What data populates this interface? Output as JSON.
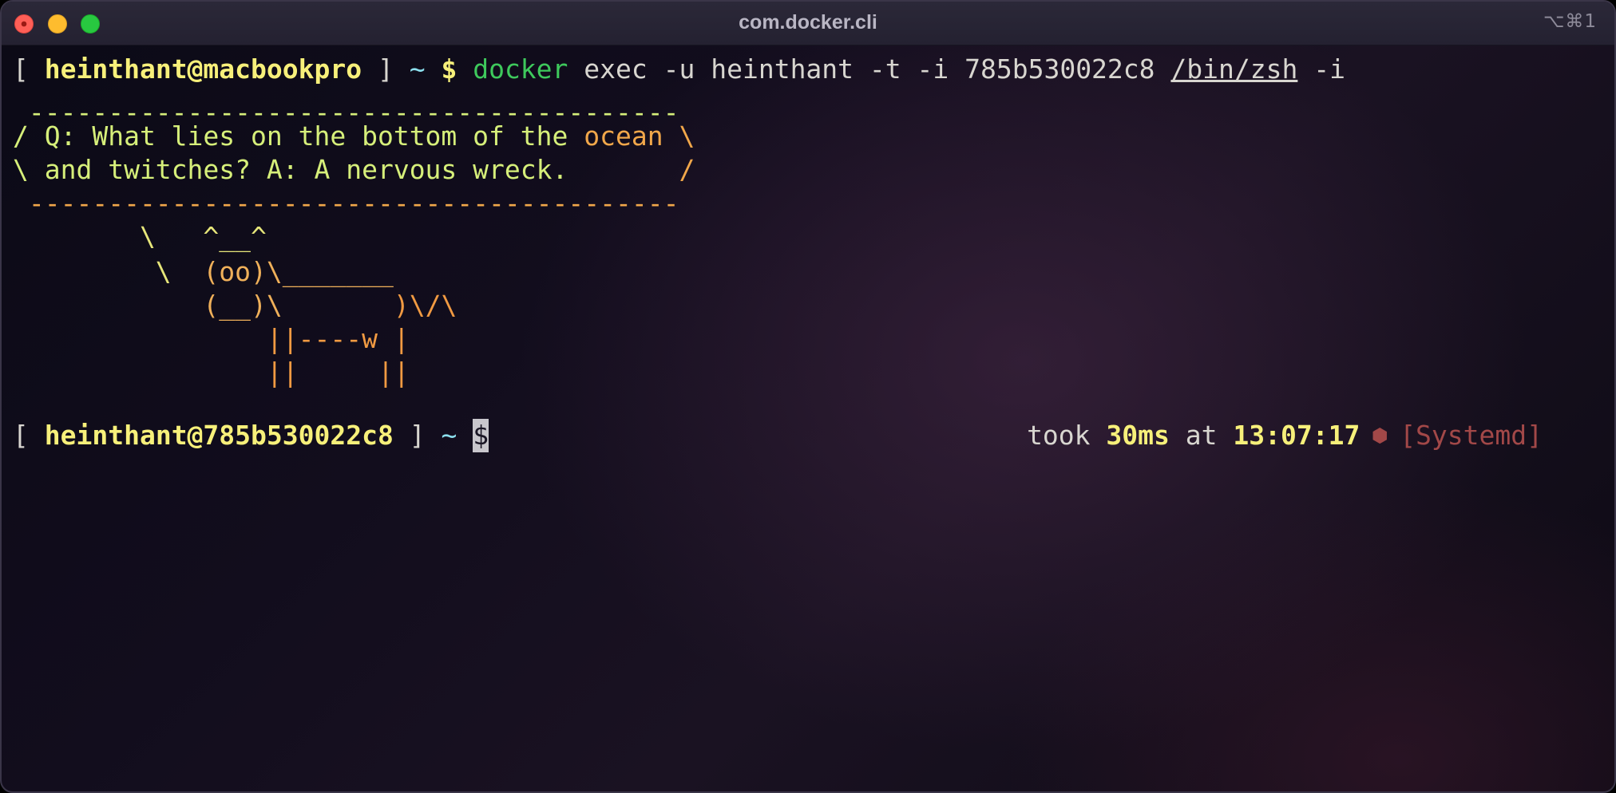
{
  "window": {
    "title": "com.docker.cli",
    "shortcut": "⌥⌘1"
  },
  "prompt1": {
    "open": "[ ",
    "user_host": "heinthant@macbookpro",
    "close": " ] ",
    "tilde": "~",
    "dollar": " $ ",
    "command": "docker",
    "args1": " exec -u heinthant -t -i 785b530022c8 ",
    "path": "/bin/zsh",
    "args2": " -i"
  },
  "fortune": {
    "top": " -----------------------------------------",
    "line1_a": "/ Q: What lies on the bottom of the ",
    "line1_b": "ocean \\",
    "line2_a": "\\ and twitches? A: A nervous wreck.",
    "line2_b": "       /",
    "bottom": " -----------------------------------------"
  },
  "cow": {
    "l1": "        \\   ^__^",
    "l2_a": "         \\  ",
    "l2_b": "(oo)\\_______",
    "l3_a": "            (__)\\",
    "l3_b": "       )\\/\\",
    "l4": "                ||----w |",
    "l5": "                ||     ||"
  },
  "prompt2": {
    "open": "[ ",
    "user_host": "heinthant@785b530022c8",
    "close": " ] ",
    "tilde": "~",
    "space": " ",
    "cursor": "$"
  },
  "status": {
    "took": "took ",
    "duration": "30ms",
    "at": " at ",
    "time": "13:07:17",
    "dot": " ⬢ ",
    "context": "[Systemd]"
  },
  "colors": {
    "yellow": "#f7f07a",
    "cyan": "#8ce0ee",
    "green": "#3ec95c",
    "systemd": "#a24848"
  }
}
